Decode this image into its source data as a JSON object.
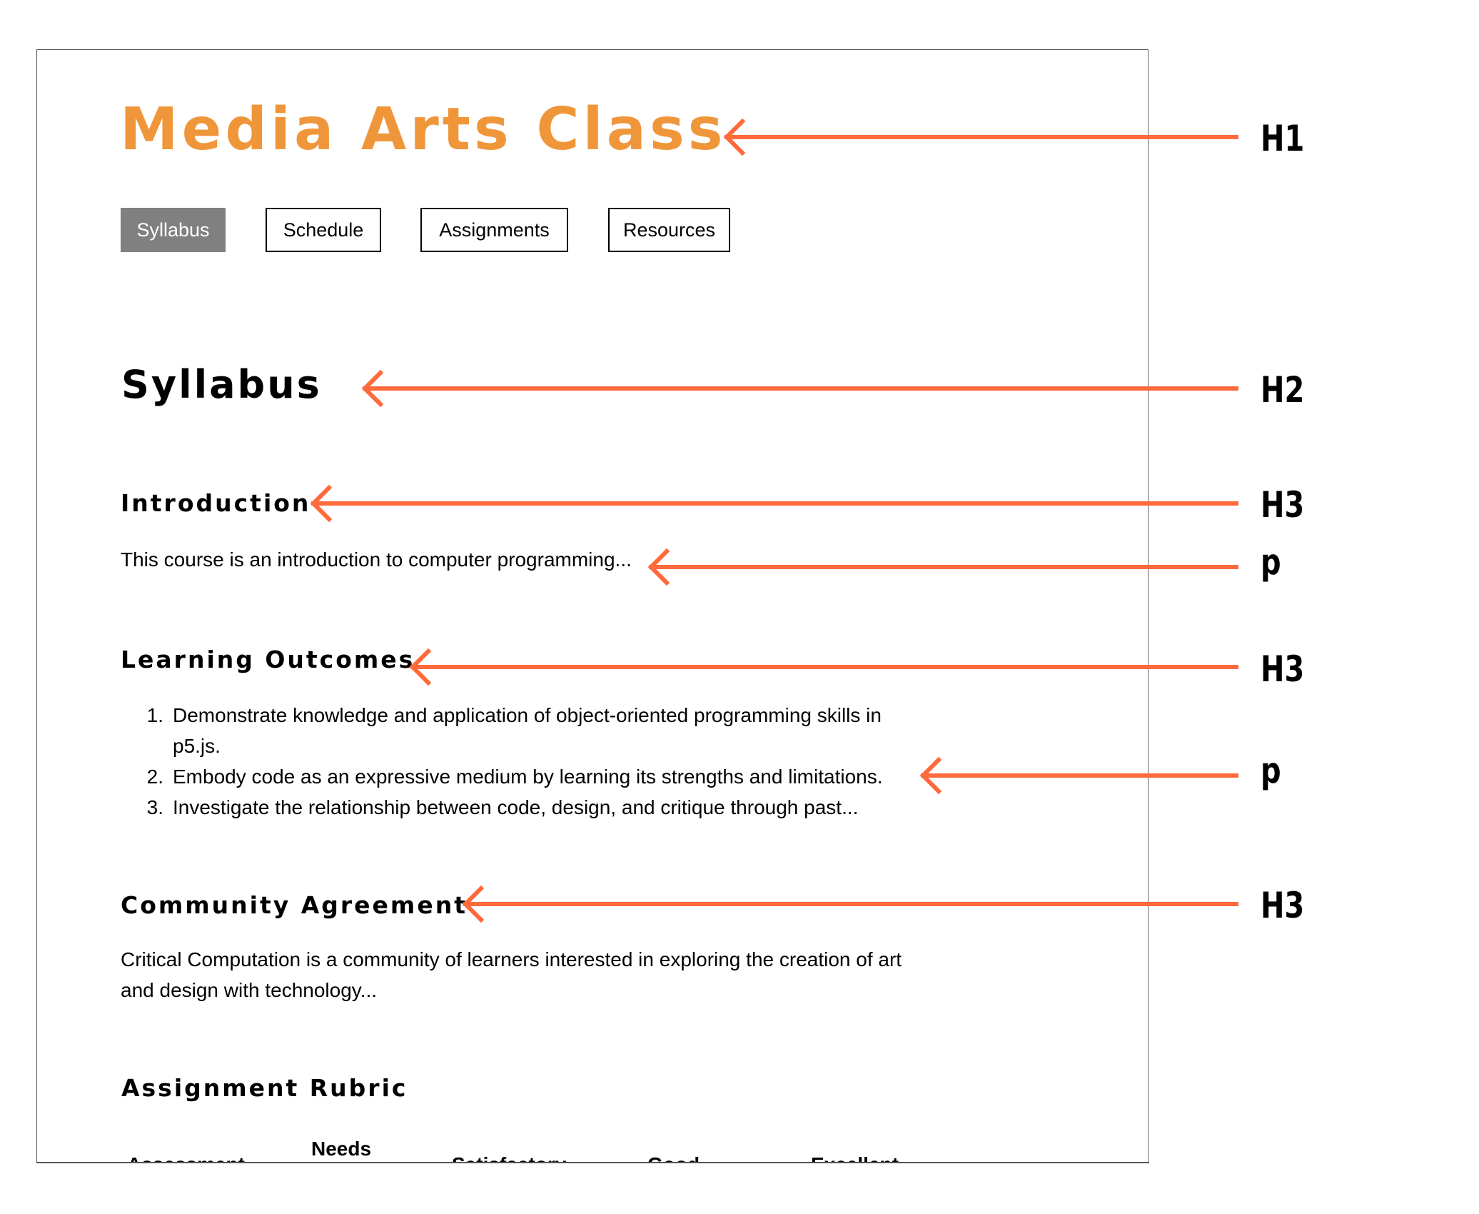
{
  "page": {
    "title": "Media Arts Class",
    "nav": [
      {
        "label": "Syllabus",
        "active": true
      },
      {
        "label": "Schedule",
        "active": false
      },
      {
        "label": "Assignments",
        "active": false
      },
      {
        "label": "Resources",
        "active": false
      }
    ],
    "section_title": "Syllabus",
    "introduction": {
      "heading": "Introduction",
      "text": "This course is an introduction to computer programming..."
    },
    "learning_outcomes": {
      "heading": "Learning Outcomes",
      "items": [
        {
          "number": "1.",
          "lines": [
            "Demonstrate knowledge and application of object-oriented programming skills in",
            "p5.js."
          ]
        },
        {
          "number": "2.",
          "lines": [
            "Embody code as an expressive medium by learning its strengths and limitations."
          ]
        },
        {
          "number": "3.",
          "lines": [
            "Investigate the relationship between code, design, and critique through past..."
          ]
        }
      ]
    },
    "community_agreement": {
      "heading": "Community Agreement",
      "lines": [
        "Critical Computation is a community of learners interested in exploring the creation of art",
        "and design with technology..."
      ]
    },
    "assignment_rubric": {
      "heading": "Assignment Rubric",
      "columns": [
        "Assessment",
        "Needs",
        "Satisfactory",
        "Good",
        "Excellent"
      ]
    }
  },
  "annotations": {
    "color": "#FF6A3D",
    "labels": [
      {
        "target": "page-title",
        "label": "H1"
      },
      {
        "target": "section-title",
        "label": "H2"
      },
      {
        "target": "introduction-heading",
        "label": "H3"
      },
      {
        "target": "introduction-paragraph",
        "label": "p"
      },
      {
        "target": "learning-outcomes-heading",
        "label": "H3"
      },
      {
        "target": "learning-outcomes-list",
        "label": "p"
      },
      {
        "target": "community-agreement-heading",
        "label": "H3"
      }
    ]
  },
  "colors": {
    "title": "#F0963A",
    "active_nav_bg": "#808080",
    "arrow": "#FF6A3D"
  }
}
